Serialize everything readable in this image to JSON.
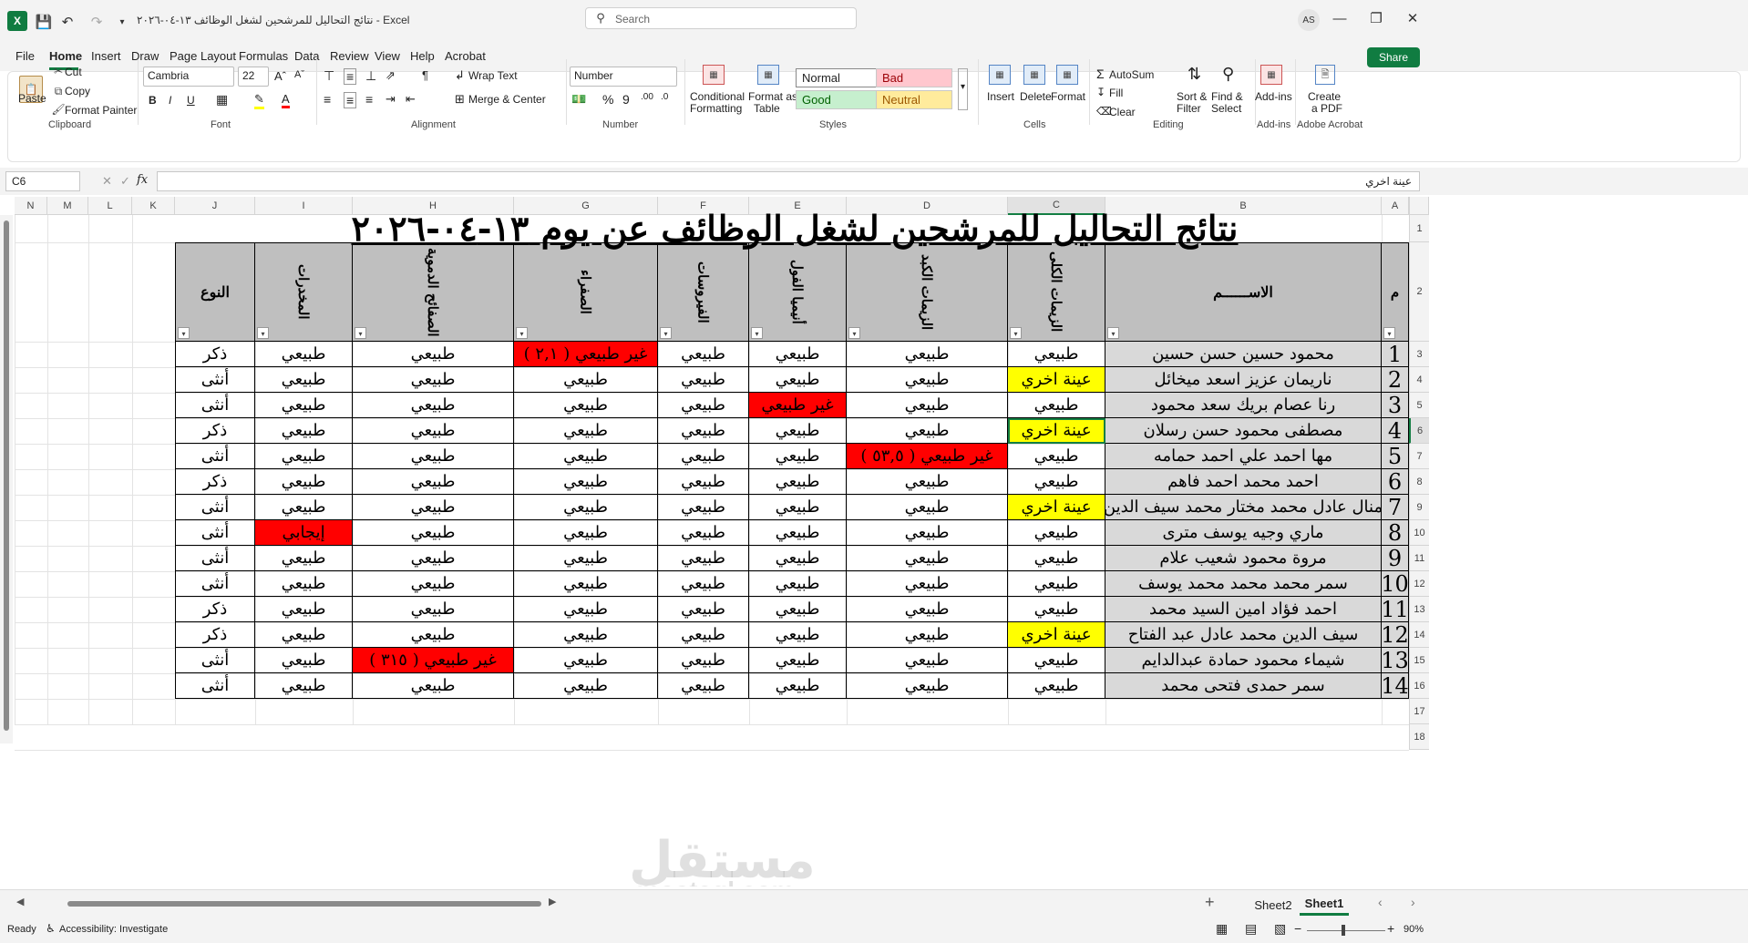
{
  "titlebar": {
    "title": "نتائج التحاليل للمرشحين لشغل الوظائف ١٣-٠٤-٢٠٢٦  -  Excel",
    "search_placeholder": "Search",
    "avatar": "AS"
  },
  "menu": [
    "File",
    "Home",
    "Insert",
    "Draw",
    "Page Layout",
    "Formulas",
    "Data",
    "Review",
    "View",
    "Help",
    "Acrobat"
  ],
  "share_label": "Share",
  "ribbon": {
    "clipboard": {
      "paste": "Paste",
      "cut": "Cut",
      "copy": "Copy",
      "format_painter": "Format Painter",
      "label": "Clipboard"
    },
    "font": {
      "name": "Cambria",
      "size": "22",
      "label": "Font"
    },
    "alignment": {
      "wrap": "Wrap Text",
      "merge": "Merge & Center",
      "label": "Alignment"
    },
    "number": {
      "format": "Number",
      "label": "Number"
    },
    "styles": {
      "cond1": "Conditional",
      "cond2": "Formatting",
      "fmt1": "Format as",
      "fmt2": "Table",
      "normal": "Normal",
      "bad": "Bad",
      "good": "Good",
      "neutral": "Neutral",
      "label": "Styles"
    },
    "cells": {
      "insert": "Insert",
      "delete": "Delete",
      "format": "Format",
      "label": "Cells"
    },
    "editing": {
      "autosum": "AutoSum",
      "fill": "Fill",
      "clear": "Clear",
      "sort1": "Sort &",
      "sort2": "Filter",
      "find1": "Find &",
      "find2": "Select",
      "label": "Editing"
    },
    "addins": {
      "addins": "Add-ins",
      "label": "Add-ins"
    },
    "acrobat": {
      "create1": "Create",
      "create2": "a PDF",
      "label": "Adobe Acrobat"
    }
  },
  "formula_bar": {
    "cell_ref": "C6",
    "fx": "fx",
    "content": "عينة اخري"
  },
  "columns": [
    "N",
    "M",
    "L",
    "K",
    "J",
    "I",
    "H",
    "G",
    "F",
    "E",
    "D",
    "C",
    "B",
    "A"
  ],
  "sheet": {
    "title": "نتائج التحاليل للمرشحين لشغل الوظائف عن يوم ١٣-٠٤-٢٠٢٦",
    "headers": {
      "num": "م",
      "name": "الاســــــم",
      "c": "الزيمات الكلى",
      "d": "الزيمات الكبد",
      "e": "أنيميا الفول",
      "f": "الفيروسات",
      "g": "الصفراء",
      "h": "الصفائح الدموية",
      "i": "المخدرات",
      "j": "النوع"
    },
    "rows": [
      {
        "row": "3",
        "num": "1",
        "name": "محمود حسين حسن حسين",
        "c": "طبيعي",
        "d": "طبيعي",
        "e": "طبيعي",
        "f": "طبيعي",
        "g": "غير طبيعي ( ٢,١ )",
        "h": "طبيعي",
        "i": "طبيعي",
        "j": "ذكر"
      },
      {
        "row": "4",
        "num": "2",
        "name": "ناريمان عزيز اسعد ميخائل",
        "c": "عينة اخري",
        "d": "طبيعي",
        "e": "طبيعي",
        "f": "طبيعي",
        "g": "طبيعي",
        "h": "طبيعي",
        "i": "طبيعي",
        "j": "أنثى"
      },
      {
        "row": "5",
        "num": "3",
        "name": "رنا عصام بريك سعد محمود",
        "c": "طبيعي",
        "d": "طبيعي",
        "e": "غير طبيعي",
        "f": "طبيعي",
        "g": "طبيعي",
        "h": "طبيعي",
        "i": "طبيعي",
        "j": "أنثى"
      },
      {
        "row": "6",
        "num": "4",
        "name": "مصطفى محمود حسن رسلان",
        "c": "عينة اخري",
        "d": "طبيعي",
        "e": "طبيعي",
        "f": "طبيعي",
        "g": "طبيعي",
        "h": "طبيعي",
        "i": "طبيعي",
        "j": "ذكر"
      },
      {
        "row": "7",
        "num": "5",
        "name": "مها احمد علي احمد حمامه",
        "c": "طبيعي",
        "d": "غير طبيعي ( ٥٣,٥ )",
        "e": "طبيعي",
        "f": "طبيعي",
        "g": "طبيعي",
        "h": "طبيعي",
        "i": "طبيعي",
        "j": "أنثى"
      },
      {
        "row": "8",
        "num": "6",
        "name": "احمد محمد احمد فاهم",
        "c": "طبيعي",
        "d": "طبيعي",
        "e": "طبيعي",
        "f": "طبيعي",
        "g": "طبيعي",
        "h": "طبيعي",
        "i": "طبيعي",
        "j": "ذكر"
      },
      {
        "row": "9",
        "num": "7",
        "name": "منال عادل محمد مختار محمد سيف الدين",
        "c": "عينة اخري",
        "d": "طبيعي",
        "e": "طبيعي",
        "f": "طبيعي",
        "g": "طبيعي",
        "h": "طبيعي",
        "i": "طبيعي",
        "j": "أنثى"
      },
      {
        "row": "10",
        "num": "8",
        "name": "ماري وجيه يوسف مترى",
        "c": "طبيعي",
        "d": "طبيعي",
        "e": "طبيعي",
        "f": "طبيعي",
        "g": "طبيعي",
        "h": "طبيعي",
        "i": "إيجابي",
        "j": "أنثى"
      },
      {
        "row": "11",
        "num": "9",
        "name": "مروة محمود شعيب علام",
        "c": "طبيعي",
        "d": "طبيعي",
        "e": "طبيعي",
        "f": "طبيعي",
        "g": "طبيعي",
        "h": "طبيعي",
        "i": "طبيعي",
        "j": "أنثى"
      },
      {
        "row": "12",
        "num": "10",
        "name": "سمر محمد محمد محمد يوسف",
        "c": "طبيعي",
        "d": "طبيعي",
        "e": "طبيعي",
        "f": "طبيعي",
        "g": "طبيعي",
        "h": "طبيعي",
        "i": "طبيعي",
        "j": "أنثى"
      },
      {
        "row": "13",
        "num": "11",
        "name": "احمد فؤاد امين السيد محمد",
        "c": "طبيعي",
        "d": "طبيعي",
        "e": "طبيعي",
        "f": "طبيعي",
        "g": "طبيعي",
        "h": "طبيعي",
        "i": "طبيعي",
        "j": "ذكر"
      },
      {
        "row": "14",
        "num": "12",
        "name": "سيف الدين محمد عادل عبد الفتاح",
        "c": "عينة اخري",
        "d": "طبيعي",
        "e": "طبيعي",
        "f": "طبيعي",
        "g": "طبيعي",
        "h": "طبيعي",
        "i": "طبيعي",
        "j": "ذكر"
      },
      {
        "row": "15",
        "num": "13",
        "name": "شيماء محمود حمادة عبدالدايم",
        "c": "طبيعي",
        "d": "طبيعي",
        "e": "طبيعي",
        "f": "طبيعي",
        "g": "طبيعي",
        "h": "غير طبيعي ( ٣١٥ )",
        "i": "طبيعي",
        "j": "أنثى"
      },
      {
        "row": "16",
        "num": "14",
        "name": "سمر حمدى فتحى محمد",
        "c": "طبيعي",
        "d": "طبيعي",
        "e": "طبيعي",
        "f": "طبيعي",
        "g": "طبيعي",
        "h": "طبيعي",
        "i": "طبيعي",
        "j": "أنثى"
      }
    ],
    "highlights": {
      "3": {
        "g": "red"
      },
      "4": {
        "c": "yel"
      },
      "5": {
        "e": "red"
      },
      "6": {
        "c": "yel"
      },
      "7": {
        "d": "red"
      },
      "9": {
        "c": "yel"
      },
      "10": {
        "i": "red"
      },
      "14": {
        "c": "yel"
      },
      "15": {
        "h": "red"
      }
    }
  },
  "row_labels_extra": [
    "1",
    "2",
    "17",
    "18"
  ],
  "watermark": {
    "text1": "مستقل",
    "text2": "mostaql.com"
  },
  "tabs": [
    "Sheet2",
    "Sheet1"
  ],
  "status": {
    "ready": "Ready",
    "accessibility": "Accessibility: Investigate",
    "zoom": "90%"
  }
}
